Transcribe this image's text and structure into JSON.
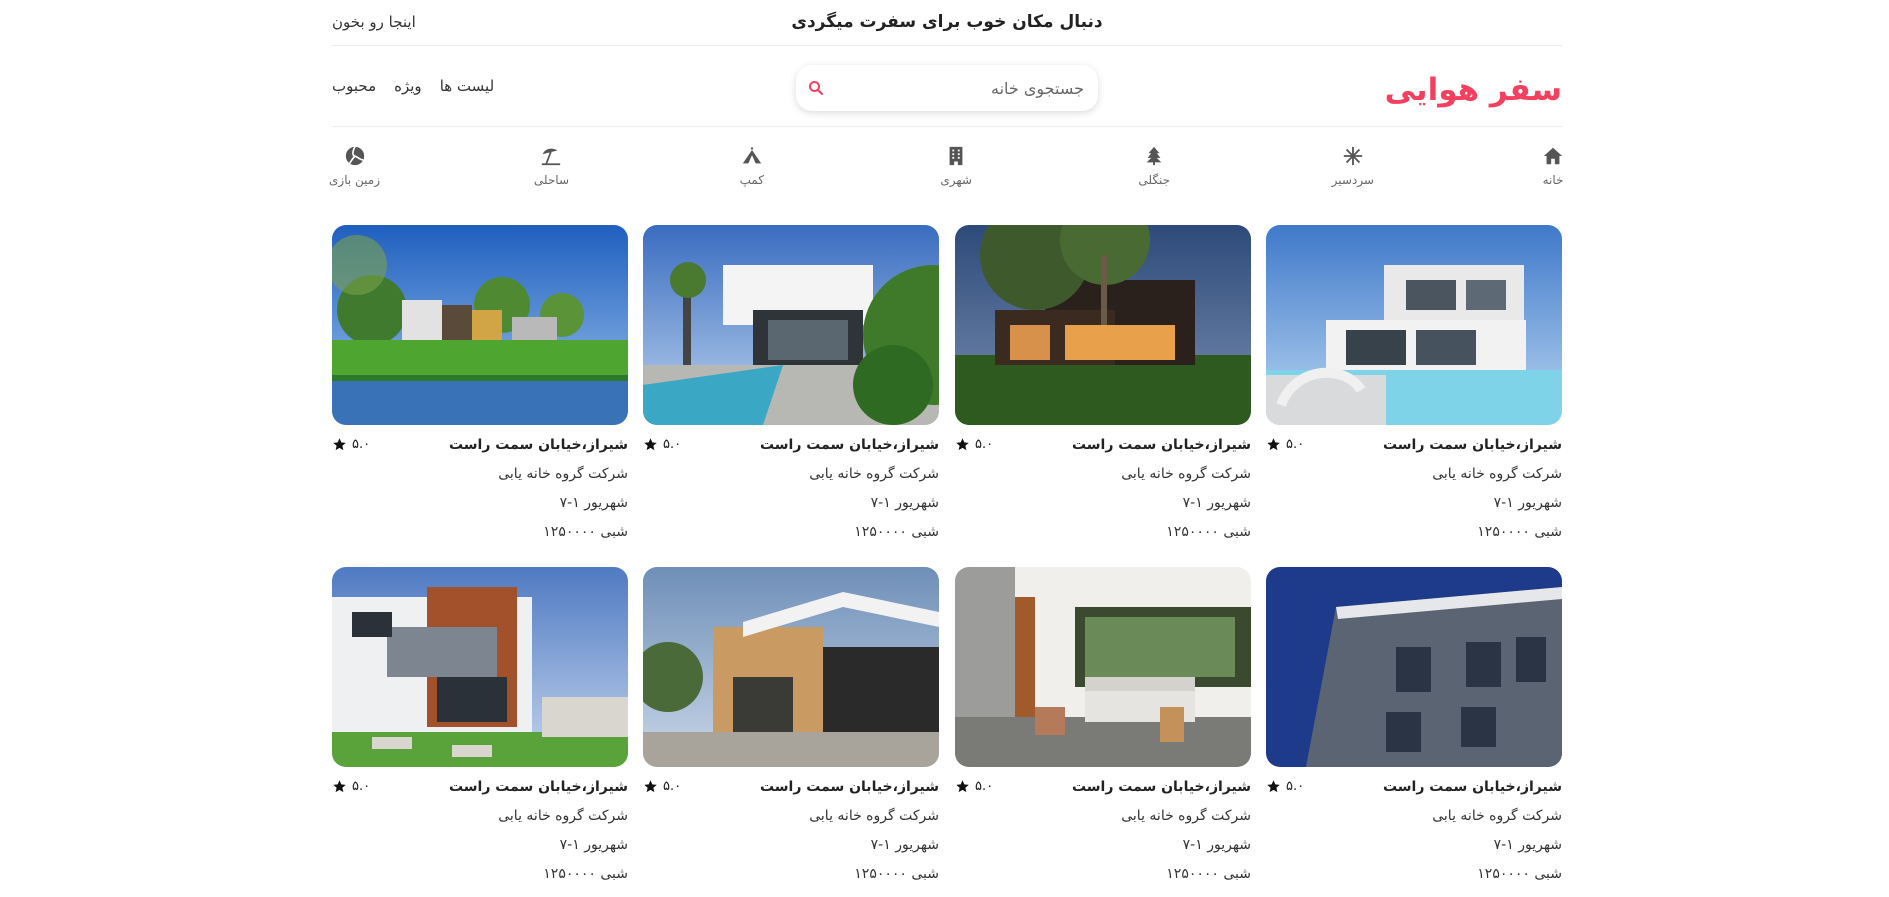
{
  "topbar": {
    "promo": "دنبال مکان خوب برای سفرت میگردی",
    "read_link": "اینجا رو بخون"
  },
  "header": {
    "logo": "سفر هوایی",
    "search_placeholder": "جستجوی خانه",
    "search_icon": "search-icon",
    "menu": [
      "لیست ها",
      "ویژه",
      "محبوب"
    ]
  },
  "categories": [
    {
      "label": "خانه",
      "icon": "home-icon"
    },
    {
      "label": "سردسیر",
      "icon": "snowflake-icon"
    },
    {
      "label": "جنگلی",
      "icon": "tree-icon"
    },
    {
      "label": "شهری",
      "icon": "building-icon"
    },
    {
      "label": "کمپ",
      "icon": "tent-icon"
    },
    {
      "label": "ساحلی",
      "icon": "umbrella-beach-icon"
    },
    {
      "label": "زمین بازی",
      "icon": "volleyball-icon"
    }
  ],
  "listings": [
    {
      "title": "شیراز،خیابان سمت راست",
      "rating": "۵.۰",
      "host": "شرکت گروه خانه یابی",
      "dates": "شهریور ۱-۷",
      "price": "شبی ۱۲۵۰۰۰۰"
    },
    {
      "title": "شیراز،خیابان سمت راست",
      "rating": "۵.۰",
      "host": "شرکت گروه خانه یابی",
      "dates": "شهریور ۱-۷",
      "price": "شبی ۱۲۵۰۰۰۰"
    },
    {
      "title": "شیراز،خیابان سمت راست",
      "rating": "۵.۰",
      "host": "شرکت گروه خانه یابی",
      "dates": "شهریور ۱-۷",
      "price": "شبی ۱۲۵۰۰۰۰"
    },
    {
      "title": "شیراز،خیابان سمت راست",
      "rating": "۵.۰",
      "host": "شرکت گروه خانه یابی",
      "dates": "شهریور ۱-۷",
      "price": "شبی ۱۲۵۰۰۰۰"
    },
    {
      "title": "شیراز،خیابان سمت راست",
      "rating": "۵.۰",
      "host": "شرکت گروه خانه یابی",
      "dates": "شهریور ۱-۷",
      "price": "شبی ۱۲۵۰۰۰۰"
    },
    {
      "title": "شیراز،خیابان سمت راست",
      "rating": "۵.۰",
      "host": "شرکت گروه خانه یابی",
      "dates": "شهریور ۱-۷",
      "price": "شبی ۱۲۵۰۰۰۰"
    },
    {
      "title": "شیراز،خیابان سمت راست",
      "rating": "۵.۰",
      "host": "شرکت گروه خانه یابی",
      "dates": "شهریور ۱-۷",
      "price": "شبی ۱۲۵۰۰۰۰"
    },
    {
      "title": "شیراز،خیابان سمت راست",
      "rating": "۵.۰",
      "host": "شرکت گروه خانه یابی",
      "dates": "شهریور ۱-۷",
      "price": "شبی ۱۲۵۰۰۰۰"
    }
  ],
  "colors": {
    "brand": "#f43f5e",
    "text": "#222222",
    "muted": "#666666"
  }
}
